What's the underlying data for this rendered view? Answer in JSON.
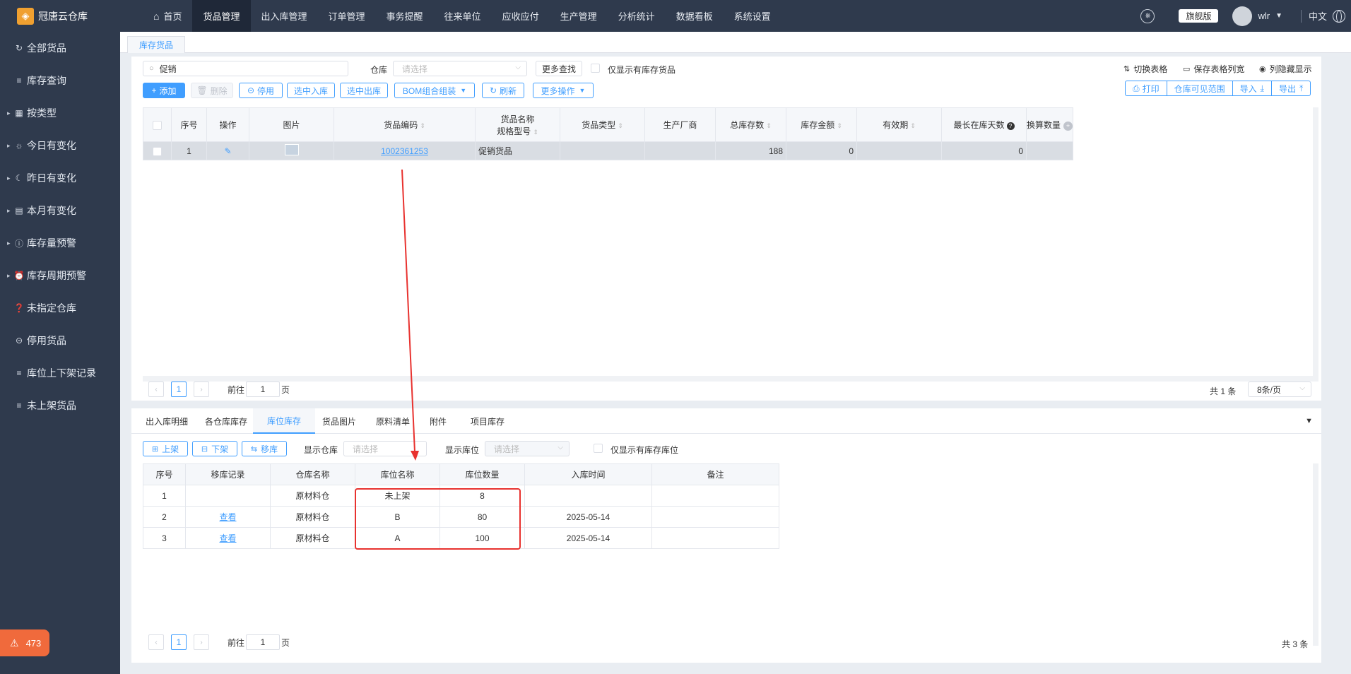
{
  "app": {
    "name": "冠唐云仓库"
  },
  "sidebar": {
    "items": [
      {
        "label": "全部货品",
        "icon": "refresh-icon",
        "glyph": "↻",
        "caret": false
      },
      {
        "label": "库存查询",
        "icon": "list-icon",
        "glyph": "≡",
        "caret": false
      },
      {
        "label": "按类型",
        "icon": "grid-icon",
        "glyph": "▦",
        "caret": true
      },
      {
        "label": "今日有变化",
        "icon": "sun-icon",
        "glyph": "☼",
        "caret": true
      },
      {
        "label": "昨日有变化",
        "icon": "moon-icon",
        "glyph": "☾",
        "caret": true
      },
      {
        "label": "本月有变化",
        "icon": "calendar-icon",
        "glyph": "▤",
        "caret": true
      },
      {
        "label": "库存量预警",
        "icon": "alert-icon",
        "glyph": "ⓘ",
        "caret": true
      },
      {
        "label": "库存周期预警",
        "icon": "alarm-icon",
        "glyph": "⏰",
        "caret": true
      },
      {
        "label": "未指定仓库",
        "icon": "question-icon",
        "glyph": "❓",
        "caret": false
      },
      {
        "label": "停用货品",
        "icon": "minus-circle-icon",
        "glyph": "⊝",
        "caret": false
      },
      {
        "label": "库位上下架记录",
        "icon": "list-icon",
        "glyph": "≡",
        "caret": false
      },
      {
        "label": "未上架货品",
        "icon": "list-icon",
        "glyph": "≡",
        "caret": false
      }
    ],
    "notification_count": "473"
  },
  "topnav": {
    "items": [
      "首页",
      "货品管理",
      "出入库管理",
      "订单管理",
      "事务提醒",
      "往来单位",
      "应收应付",
      "生产管理",
      "分析统计",
      "数据看板",
      "系统设置"
    ],
    "active_index": 1,
    "edition": "旗舰版",
    "user": "wlr",
    "lang": "中文"
  },
  "page_tab": "库存货品",
  "filter": {
    "search_value": "促销",
    "warehouse_label": "仓库",
    "warehouse_placeholder": "请选择",
    "more_search": "更多查找",
    "only_stock_label": "仅显示有库存货品"
  },
  "toolbar": {
    "add": "添加",
    "delete": "删除",
    "disable": "停用",
    "stock_in": "选中入库",
    "stock_out": "选中出库",
    "bom": "BOM组合组装",
    "refresh": "刷新",
    "more_ops": "更多操作",
    "switch_table": "切换表格",
    "save_widths": "保存表格列宽",
    "hide_cols": "列隐藏显示",
    "print": "打印",
    "wh_scope": "仓库可见范围",
    "import": "导入",
    "export": "导出"
  },
  "main_table": {
    "headers": {
      "seq": "序号",
      "op": "操作",
      "img": "图片",
      "code": "货品编码",
      "name": "货品名称",
      "spec": "规格型号",
      "type": "货品类型",
      "maker": "生产厂商",
      "total": "总库存数",
      "amount": "库存金额",
      "expiry": "有效期",
      "max_days": "最长在库天数",
      "convert": "换算数量"
    },
    "rows": [
      {
        "seq": "1",
        "code": "1002361253",
        "name": "促销货品",
        "type": "",
        "maker": "",
        "total": "188",
        "amount": "0",
        "expiry": "",
        "max_days": "0",
        "convert": ""
      }
    ]
  },
  "pager_top": {
    "page": "1",
    "goto_prefix": "前往",
    "goto_value": "1",
    "goto_suffix": "页",
    "total": "共 1 条",
    "page_size": "8条/页"
  },
  "bottom_tabs": {
    "items": [
      "出入库明细",
      "各仓库库存",
      "库位库存",
      "货品图片",
      "原料清单",
      "附件",
      "项目库存"
    ],
    "active_index": 2
  },
  "location_toolbar": {
    "shelve": "上架",
    "unshelve": "下架",
    "move": "移库",
    "show_wh_label": "显示仓库",
    "show_wh_placeholder": "请选择",
    "show_loc_label": "显示库位",
    "show_loc_placeholder": "请选择",
    "only_loc_label": "仅显示有库存库位"
  },
  "location_table": {
    "headers": {
      "seq": "序号",
      "move": "移库记录",
      "wh": "仓库名称",
      "loc": "库位名称",
      "qty": "库位数量",
      "time": "入库时间",
      "note": "备注"
    },
    "rows": [
      {
        "seq": "1",
        "move": "",
        "wh": "原材料仓",
        "loc": "未上架",
        "qty": "8",
        "time": "",
        "note": ""
      },
      {
        "seq": "2",
        "move": "查看",
        "wh": "原材料仓",
        "loc": "B",
        "qty": "80",
        "time": "2025-05-14",
        "note": ""
      },
      {
        "seq": "3",
        "move": "查看",
        "wh": "原材料仓",
        "loc": "A",
        "qty": "100",
        "time": "2025-05-14",
        "note": ""
      }
    ]
  },
  "pager_bottom": {
    "page": "1",
    "goto_prefix": "前往",
    "goto_value": "1",
    "goto_suffix": "页",
    "total": "共 3 条"
  },
  "colors": {
    "accent": "#409eff",
    "annotation": "#e8322f",
    "nav_bg": "#2f3a4d",
    "badge": "#f06a3c"
  }
}
